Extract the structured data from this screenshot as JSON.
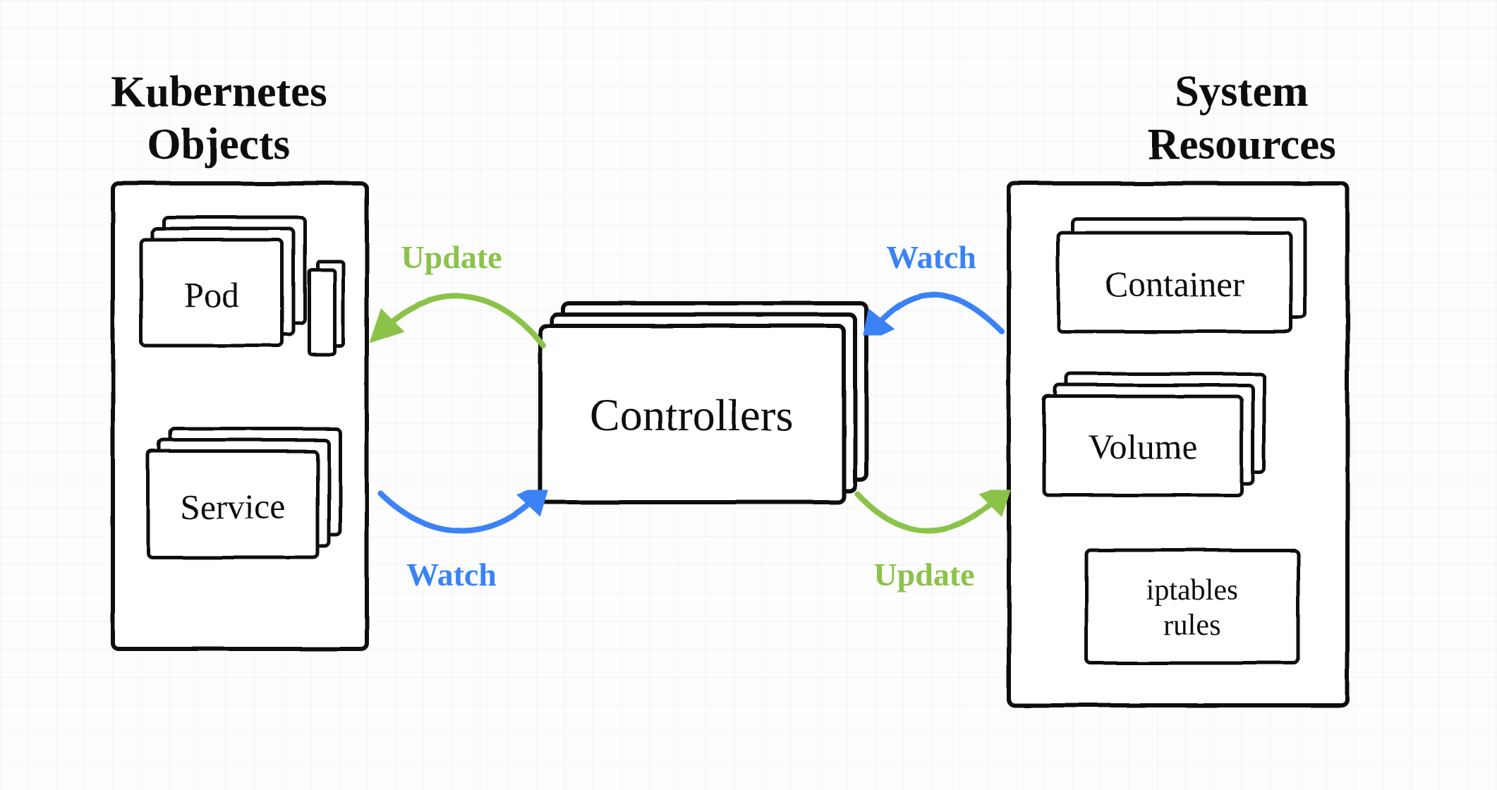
{
  "left": {
    "title_line1": "Kubernetes",
    "title_line2": "Objects",
    "items": {
      "pod": "Pod",
      "service": "Service"
    }
  },
  "center": {
    "title": "Controllers"
  },
  "right": {
    "title_line1": "System",
    "title_line2": "Resources",
    "items": {
      "container": "Container",
      "volume": "Volume",
      "iptables_line1": "iptables",
      "iptables_line2": "rules"
    }
  },
  "arrows": {
    "left_top": "Update",
    "left_bottom": "Watch",
    "right_top": "Watch",
    "right_bottom": "Update"
  },
  "colors": {
    "watch": "#3b82f6",
    "update": "#8bc34a",
    "stroke": "#111111"
  }
}
